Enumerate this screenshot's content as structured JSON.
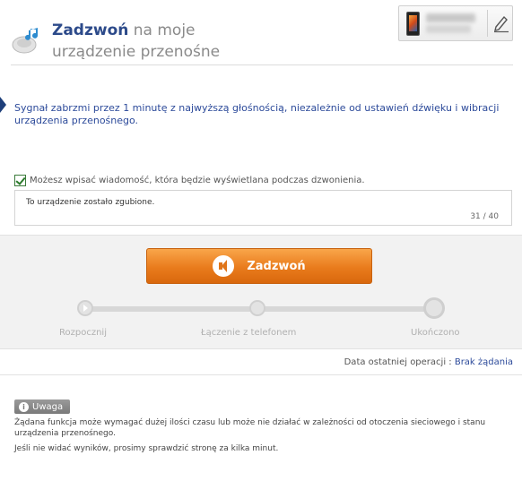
{
  "header": {
    "title_strong": "Zadzwoń",
    "title_rest": " na moje urządzenie przenośne"
  },
  "info": {
    "text": "Sygnał zabrzmi przez 1 minutę z najwyższą głośnością, niezależnie od ustawień dźwięku i wibracji urządzenia przenośnego."
  },
  "message": {
    "checkbox_label": "Możesz wpisać wiadomość, która będzie wyświetlana podczas dzwonienia.",
    "value": "To urządzenie zostało zgubione.",
    "counter": "31 / 40"
  },
  "call": {
    "button_label": "Zadzwoń"
  },
  "progress": {
    "steps": [
      "Rozpocznij",
      "Łączenie z telefonem",
      "Ukończono"
    ]
  },
  "last_operation": {
    "label": "Data ostatniej operacji : ",
    "value": "Brak żądania"
  },
  "warning": {
    "badge": "Uwaga",
    "text1": "Żądana funkcja może wymagać dużej ilości czasu lub może nie działać w zależności od otoczenia sieciowego i stanu urządzenia przenośnego.",
    "text2": "Jeśli nie widać wyników, prosimy sprawdzić stronę za kilka minut."
  },
  "colors": {
    "accent_orange": "#e97b1c",
    "title_blue": "#2c4a8a",
    "info_blue": "#2c4a9a"
  }
}
